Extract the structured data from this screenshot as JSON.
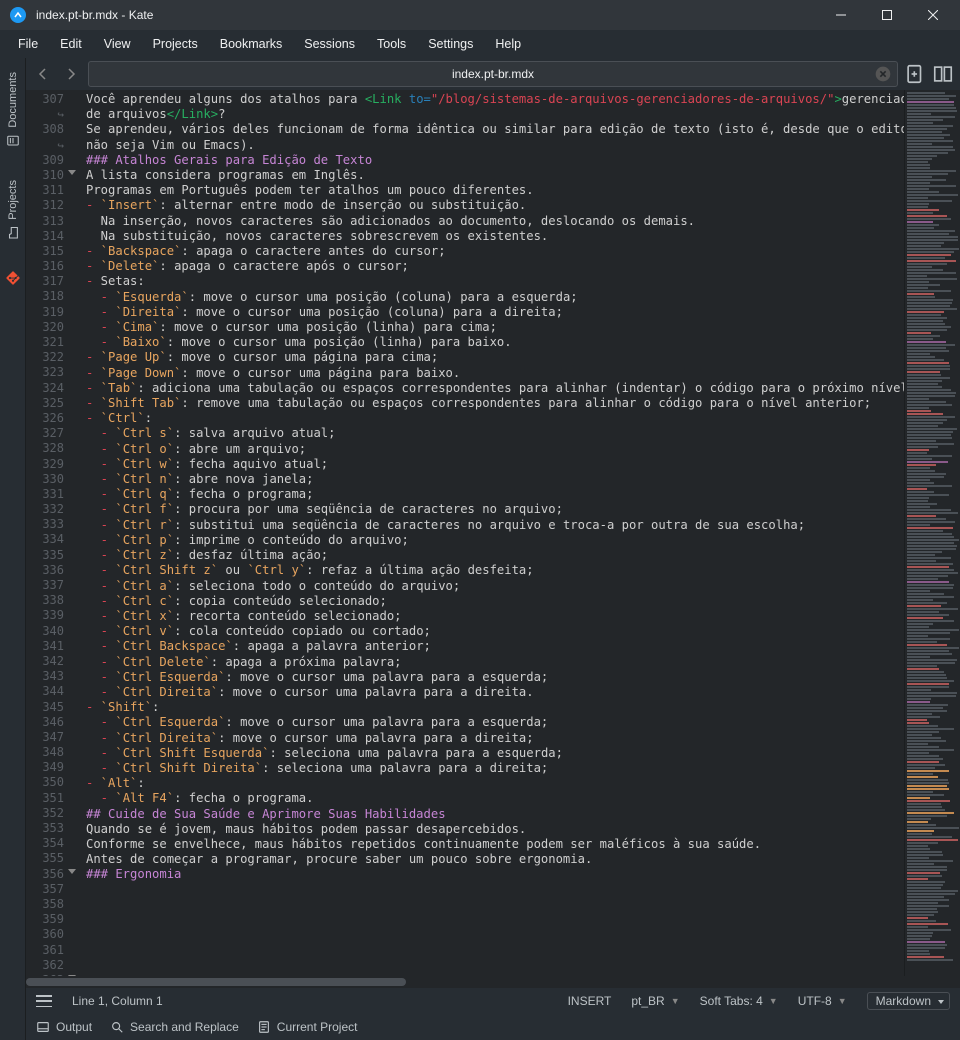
{
  "window": {
    "title": "index.pt-br.mdx  - Kate"
  },
  "menubar": [
    "File",
    "Edit",
    "View",
    "Projects",
    "Bookmarks",
    "Sessions",
    "Tools",
    "Settings",
    "Help"
  ],
  "sidebar": {
    "tabs": [
      {
        "label": "Documents"
      },
      {
        "label": "Projects"
      },
      {
        "label": "Git"
      }
    ]
  },
  "tab": {
    "label": "index.pt-br.mdx"
  },
  "gutter": {
    "start": 307,
    "end": 363,
    "folds": [
      310,
      356,
      363
    ],
    "wraps_after": [
      307,
      308
    ]
  },
  "code": {
    "lines": [
      {
        "n": 307,
        "segs": [
          {
            "t": "Você aprendeu alguns dos atalhos para ",
            "c": "c-text"
          },
          {
            "t": "<Link",
            "c": "c-tag"
          },
          {
            "t": " to=",
            "c": "c-attr"
          },
          {
            "t": "\"/blog/sistemas-de-arquivos-gerenciadores-de-arquivos/\"",
            "c": "c-str"
          },
          {
            "t": ">",
            "c": "c-tag"
          },
          {
            "t": "gerenciadores",
            "c": "c-text"
          }
        ]
      },
      {
        "n": "307w",
        "segs": [
          {
            "t": "de arquivos",
            "c": "c-text"
          },
          {
            "t": "</Link>",
            "c": "c-tag"
          },
          {
            "t": "?",
            "c": "c-text"
          }
        ]
      },
      {
        "n": 308,
        "segs": [
          {
            "t": "Se aprendeu, vários deles funcionam de forma idêntica ou similar para edição de texto (isto é, desde que o editor",
            "c": "c-text"
          }
        ]
      },
      {
        "n": "308w",
        "segs": [
          {
            "t": "não seja Vim ou Emacs).",
            "c": "c-text"
          }
        ]
      },
      {
        "n": 309,
        "segs": [
          {
            "t": "",
            "c": "c-text"
          }
        ]
      },
      {
        "n": 310,
        "segs": [
          {
            "t": "### Atalhos Gerais para Edição de Texto",
            "c": "c-head"
          }
        ]
      },
      {
        "n": 311,
        "segs": [
          {
            "t": "",
            "c": "c-text"
          }
        ]
      },
      {
        "n": 312,
        "segs": [
          {
            "t": "A lista considera programas em Inglês.",
            "c": "c-text"
          }
        ]
      },
      {
        "n": 313,
        "segs": [
          {
            "t": "Programas em Português podem ter atalhos um pouco diferentes.",
            "c": "c-text"
          }
        ]
      },
      {
        "n": 314,
        "segs": [
          {
            "t": "",
            "c": "c-text"
          }
        ]
      },
      {
        "n": 315,
        "segs": [
          {
            "t": "-",
            "c": "c-bullet"
          },
          {
            "t": " `Insert`",
            "c": "c-key"
          },
          {
            "t": ": alternar entre modo de inserção ou substituição.",
            "c": "c-text"
          }
        ]
      },
      {
        "n": 316,
        "segs": [
          {
            "t": "  Na inserção, novos caracteres são adicionados ao documento, deslocando os demais.",
            "c": "c-text"
          }
        ]
      },
      {
        "n": 317,
        "segs": [
          {
            "t": "  Na substituição, novos caracteres sobrescrevem os existentes.",
            "c": "c-text"
          }
        ]
      },
      {
        "n": 318,
        "segs": [
          {
            "t": "-",
            "c": "c-bullet"
          },
          {
            "t": " `Backspace`",
            "c": "c-key"
          },
          {
            "t": ": apaga o caractere antes do cursor;",
            "c": "c-text"
          }
        ]
      },
      {
        "n": 319,
        "segs": [
          {
            "t": "-",
            "c": "c-bullet"
          },
          {
            "t": " `Delete`",
            "c": "c-key"
          },
          {
            "t": ": apaga o caractere após o cursor;",
            "c": "c-text"
          }
        ]
      },
      {
        "n": 320,
        "segs": [
          {
            "t": "-",
            "c": "c-bullet"
          },
          {
            "t": " Setas:",
            "c": "c-text"
          }
        ]
      },
      {
        "n": 321,
        "segs": [
          {
            "t": "  -",
            "c": "c-bullet"
          },
          {
            "t": " `Esquerda`",
            "c": "c-key"
          },
          {
            "t": ": move o cursor uma posição (coluna) para a esquerda;",
            "c": "c-text"
          }
        ]
      },
      {
        "n": 322,
        "segs": [
          {
            "t": "  -",
            "c": "c-bullet"
          },
          {
            "t": " `Direita`",
            "c": "c-key"
          },
          {
            "t": ": move o cursor uma posição (coluna) para a direita;",
            "c": "c-text"
          }
        ]
      },
      {
        "n": 323,
        "segs": [
          {
            "t": "  -",
            "c": "c-bullet"
          },
          {
            "t": " `Cima`",
            "c": "c-key"
          },
          {
            "t": ": move o cursor uma posição (linha) para cima;",
            "c": "c-text"
          }
        ]
      },
      {
        "n": 324,
        "segs": [
          {
            "t": "  -",
            "c": "c-bullet"
          },
          {
            "t": " `Baixo`",
            "c": "c-key"
          },
          {
            "t": ": move o cursor uma posição (linha) para baixo.",
            "c": "c-text"
          }
        ]
      },
      {
        "n": 325,
        "segs": [
          {
            "t": "-",
            "c": "c-bullet"
          },
          {
            "t": " `Page Up`",
            "c": "c-key"
          },
          {
            "t": ": move o cursor uma página para cima;",
            "c": "c-text"
          }
        ]
      },
      {
        "n": 326,
        "segs": [
          {
            "t": "-",
            "c": "c-bullet"
          },
          {
            "t": " `Page Down`",
            "c": "c-key"
          },
          {
            "t": ": move o cursor uma página para baixo.",
            "c": "c-text"
          }
        ]
      },
      {
        "n": 327,
        "segs": [
          {
            "t": "-",
            "c": "c-bullet"
          },
          {
            "t": " `Tab`",
            "c": "c-key"
          },
          {
            "t": ": adiciona uma tabulação ou espaços correspondentes para alinhar (indentar) o código para o próximo nível;",
            "c": "c-text"
          }
        ]
      },
      {
        "n": 328,
        "segs": [
          {
            "t": "-",
            "c": "c-bullet"
          },
          {
            "t": " `Shift Tab`",
            "c": "c-key"
          },
          {
            "t": ": remove uma tabulação ou espaços correspondentes para alinhar o código para o nível anterior;",
            "c": "c-text"
          }
        ]
      },
      {
        "n": 329,
        "segs": [
          {
            "t": "-",
            "c": "c-bullet"
          },
          {
            "t": " `Ctrl`",
            "c": "c-key"
          },
          {
            "t": ":",
            "c": "c-text"
          }
        ]
      },
      {
        "n": 330,
        "segs": [
          {
            "t": "  -",
            "c": "c-bullet"
          },
          {
            "t": " `Ctrl s`",
            "c": "c-key"
          },
          {
            "t": ": salva arquivo atual;",
            "c": "c-text"
          }
        ]
      },
      {
        "n": 331,
        "segs": [
          {
            "t": "  -",
            "c": "c-bullet"
          },
          {
            "t": " `Ctrl o`",
            "c": "c-key"
          },
          {
            "t": ": abre um arquivo;",
            "c": "c-text"
          }
        ]
      },
      {
        "n": 332,
        "segs": [
          {
            "t": "  -",
            "c": "c-bullet"
          },
          {
            "t": " `Ctrl w`",
            "c": "c-key"
          },
          {
            "t": ": fecha aquivo atual;",
            "c": "c-text"
          }
        ]
      },
      {
        "n": 333,
        "segs": [
          {
            "t": "  -",
            "c": "c-bullet"
          },
          {
            "t": " `Ctrl n`",
            "c": "c-key"
          },
          {
            "t": ": abre nova janela;",
            "c": "c-text"
          }
        ]
      },
      {
        "n": 334,
        "segs": [
          {
            "t": "  -",
            "c": "c-bullet"
          },
          {
            "t": " `Ctrl q`",
            "c": "c-key"
          },
          {
            "t": ": fecha o programa;",
            "c": "c-text"
          }
        ]
      },
      {
        "n": 335,
        "segs": [
          {
            "t": "  -",
            "c": "c-bullet"
          },
          {
            "t": " `Ctrl f`",
            "c": "c-key"
          },
          {
            "t": ": procura por uma seqüência de caracteres no arquivo;",
            "c": "c-text"
          }
        ]
      },
      {
        "n": 336,
        "segs": [
          {
            "t": "  -",
            "c": "c-bullet"
          },
          {
            "t": " `Ctrl r`",
            "c": "c-key"
          },
          {
            "t": ": substitui uma seqüência de caracteres no arquivo e troca-a por outra de sua escolha;",
            "c": "c-text"
          }
        ]
      },
      {
        "n": 337,
        "segs": [
          {
            "t": "  -",
            "c": "c-bullet"
          },
          {
            "t": " `Ctrl p`",
            "c": "c-key"
          },
          {
            "t": ": imprime o conteúdo do arquivo;",
            "c": "c-text"
          }
        ]
      },
      {
        "n": 338,
        "segs": [
          {
            "t": "  -",
            "c": "c-bullet"
          },
          {
            "t": " `Ctrl z`",
            "c": "c-key"
          },
          {
            "t": ": desfaz última ação;",
            "c": "c-text"
          }
        ]
      },
      {
        "n": 339,
        "segs": [
          {
            "t": "  -",
            "c": "c-bullet"
          },
          {
            "t": " `Ctrl Shift z`",
            "c": "c-key"
          },
          {
            "t": " ou ",
            "c": "c-text"
          },
          {
            "t": "`Ctrl y`",
            "c": "c-key"
          },
          {
            "t": ": refaz a última ação desfeita;",
            "c": "c-text"
          }
        ]
      },
      {
        "n": 340,
        "segs": [
          {
            "t": "  -",
            "c": "c-bullet"
          },
          {
            "t": " `Ctrl a`",
            "c": "c-key"
          },
          {
            "t": ": seleciona todo o conteúdo do arquivo;",
            "c": "c-text"
          }
        ]
      },
      {
        "n": 341,
        "segs": [
          {
            "t": "  -",
            "c": "c-bullet"
          },
          {
            "t": " `Ctrl c`",
            "c": "c-key"
          },
          {
            "t": ": copia conteúdo selecionado;",
            "c": "c-text"
          }
        ]
      },
      {
        "n": 342,
        "segs": [
          {
            "t": "  -",
            "c": "c-bullet"
          },
          {
            "t": " `Ctrl x`",
            "c": "c-key"
          },
          {
            "t": ": recorta conteúdo selecionado;",
            "c": "c-text"
          }
        ]
      },
      {
        "n": 343,
        "segs": [
          {
            "t": "  -",
            "c": "c-bullet"
          },
          {
            "t": " `Ctrl v`",
            "c": "c-key"
          },
          {
            "t": ": cola conteúdo copiado ou cortado;",
            "c": "c-text"
          }
        ]
      },
      {
        "n": 344,
        "segs": [
          {
            "t": "  -",
            "c": "c-bullet"
          },
          {
            "t": " `Ctrl Backspace`",
            "c": "c-key"
          },
          {
            "t": ": apaga a palavra anterior;",
            "c": "c-text"
          }
        ]
      },
      {
        "n": 345,
        "segs": [
          {
            "t": "  -",
            "c": "c-bullet"
          },
          {
            "t": " `Ctrl Delete`",
            "c": "c-key"
          },
          {
            "t": ": apaga a próxima palavra;",
            "c": "c-text"
          }
        ]
      },
      {
        "n": 346,
        "segs": [
          {
            "t": "  -",
            "c": "c-bullet"
          },
          {
            "t": " `Ctrl Esquerda`",
            "c": "c-key"
          },
          {
            "t": ": move o cursor uma palavra para a esquerda;",
            "c": "c-text"
          }
        ]
      },
      {
        "n": 347,
        "segs": [
          {
            "t": "  -",
            "c": "c-bullet"
          },
          {
            "t": " `Ctrl Direita`",
            "c": "c-key"
          },
          {
            "t": ": move o cursor uma palavra para a direita.",
            "c": "c-text"
          }
        ]
      },
      {
        "n": 348,
        "segs": [
          {
            "t": "-",
            "c": "c-bullet"
          },
          {
            "t": " `Shift`",
            "c": "c-key"
          },
          {
            "t": ":",
            "c": "c-text"
          }
        ]
      },
      {
        "n": 349,
        "segs": [
          {
            "t": "  -",
            "c": "c-bullet"
          },
          {
            "t": " `Ctrl Esquerda`",
            "c": "c-key"
          },
          {
            "t": ": move o cursor uma palavra para a esquerda;",
            "c": "c-text"
          }
        ]
      },
      {
        "n": 350,
        "segs": [
          {
            "t": "  -",
            "c": "c-bullet"
          },
          {
            "t": " `Ctrl Direita`",
            "c": "c-key"
          },
          {
            "t": ": move o cursor uma palavra para a direita;",
            "c": "c-text"
          }
        ]
      },
      {
        "n": 351,
        "segs": [
          {
            "t": "  -",
            "c": "c-bullet"
          },
          {
            "t": " `Ctrl Shift Esquerda`",
            "c": "c-key"
          },
          {
            "t": ": seleciona uma palavra para a esquerda;",
            "c": "c-text"
          }
        ]
      },
      {
        "n": 352,
        "segs": [
          {
            "t": "  -",
            "c": "c-bullet"
          },
          {
            "t": " `Ctrl Shift Direita`",
            "c": "c-key"
          },
          {
            "t": ": seleciona uma palavra para a direita;",
            "c": "c-text"
          }
        ]
      },
      {
        "n": 353,
        "segs": [
          {
            "t": "-",
            "c": "c-bullet"
          },
          {
            "t": " `Alt`",
            "c": "c-key"
          },
          {
            "t": ":",
            "c": "c-text"
          }
        ]
      },
      {
        "n": 354,
        "segs": [
          {
            "t": "  -",
            "c": "c-bullet"
          },
          {
            "t": " `Alt F4`",
            "c": "c-key"
          },
          {
            "t": ": fecha o programa.",
            "c": "c-text"
          }
        ]
      },
      {
        "n": 355,
        "segs": [
          {
            "t": "",
            "c": "c-text"
          }
        ]
      },
      {
        "n": 356,
        "segs": [
          {
            "t": "## Cuide de Sua Saúde e Aprimore Suas Habilidades",
            "c": "c-head"
          }
        ]
      },
      {
        "n": 357,
        "segs": [
          {
            "t": "",
            "c": "c-text"
          }
        ]
      },
      {
        "n": 358,
        "segs": [
          {
            "t": "Quando se é jovem, maus hábitos podem passar desapercebidos.",
            "c": "c-text"
          }
        ]
      },
      {
        "n": 359,
        "segs": [
          {
            "t": "Conforme se envelhece, maus hábitos repetidos continuamente podem ser maléficos à sua saúde.",
            "c": "c-text"
          }
        ]
      },
      {
        "n": 360,
        "segs": [
          {
            "t": "",
            "c": "c-text"
          }
        ]
      },
      {
        "n": 361,
        "segs": [
          {
            "t": "Antes de começar a programar, procure saber um pouco sobre ergonomia.",
            "c": "c-text"
          }
        ]
      },
      {
        "n": 362,
        "segs": [
          {
            "t": "",
            "c": "c-text"
          }
        ]
      },
      {
        "n": 363,
        "segs": [
          {
            "t": "### Ergonomia",
            "c": "c-head"
          }
        ]
      }
    ]
  },
  "status": {
    "cursor": "Line 1, Column 1",
    "mode": "INSERT",
    "lang": "pt_BR",
    "indent": "Soft Tabs: 4",
    "encoding": "UTF-8",
    "syntax": "Markdown"
  },
  "bottom": {
    "output": "Output",
    "search": "Search and Replace",
    "project": "Current Project"
  }
}
